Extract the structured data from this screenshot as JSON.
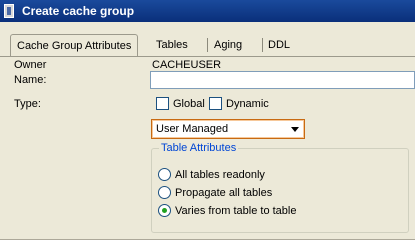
{
  "window": {
    "title": "Create cache group"
  },
  "tabs": [
    {
      "label": "Cache Group Attributes",
      "active": true
    },
    {
      "label": "Tables",
      "active": false
    },
    {
      "label": "Aging",
      "active": false
    },
    {
      "label": "DDL",
      "active": false
    }
  ],
  "form": {
    "owner_label": "Owner",
    "owner_value": "CACHEUSER",
    "name_label": "Name:",
    "name_value": "",
    "type_label": "Type:",
    "global_label": "Global",
    "dynamic_label": "Dynamic",
    "type_select_value": "User Managed"
  },
  "table_attributes": {
    "title": "Table Attributes",
    "options": [
      {
        "label": "All tables readonly",
        "checked": false
      },
      {
        "label": "Propagate all tables",
        "checked": false
      },
      {
        "label": "Varies from table to table",
        "checked": true
      }
    ]
  }
}
